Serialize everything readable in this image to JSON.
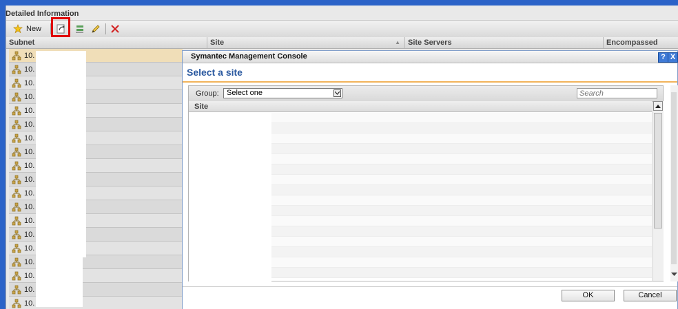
{
  "panel": {
    "title": "Detailed Information"
  },
  "toolbar": {
    "new_label": "New"
  },
  "grid": {
    "columns": [
      "Subnet",
      "Site",
      "Site Servers",
      "Encompassed"
    ],
    "rows": [
      "10.",
      "10.",
      "10.",
      "10.",
      "10.",
      "10.",
      "10.",
      "10.",
      "10.",
      "10.",
      "10.",
      "10.",
      "10.",
      "10.",
      "10.",
      "10.",
      "10.",
      "10.",
      "10."
    ]
  },
  "dialog": {
    "title": "Symantec Management Console",
    "help_label": "?",
    "close_label": "X",
    "heading": "Select a site",
    "group_label": "Group:",
    "group_value": "Select one",
    "search_placeholder": "Search",
    "site_column": "Site",
    "ok_label": "OK",
    "cancel_label": "Cancel"
  },
  "colors": {
    "frame_blue": "#2b63c8",
    "highlight_red": "#e00000",
    "heading_blue": "#2c5aa0",
    "selected_row": "#f0deb8"
  }
}
